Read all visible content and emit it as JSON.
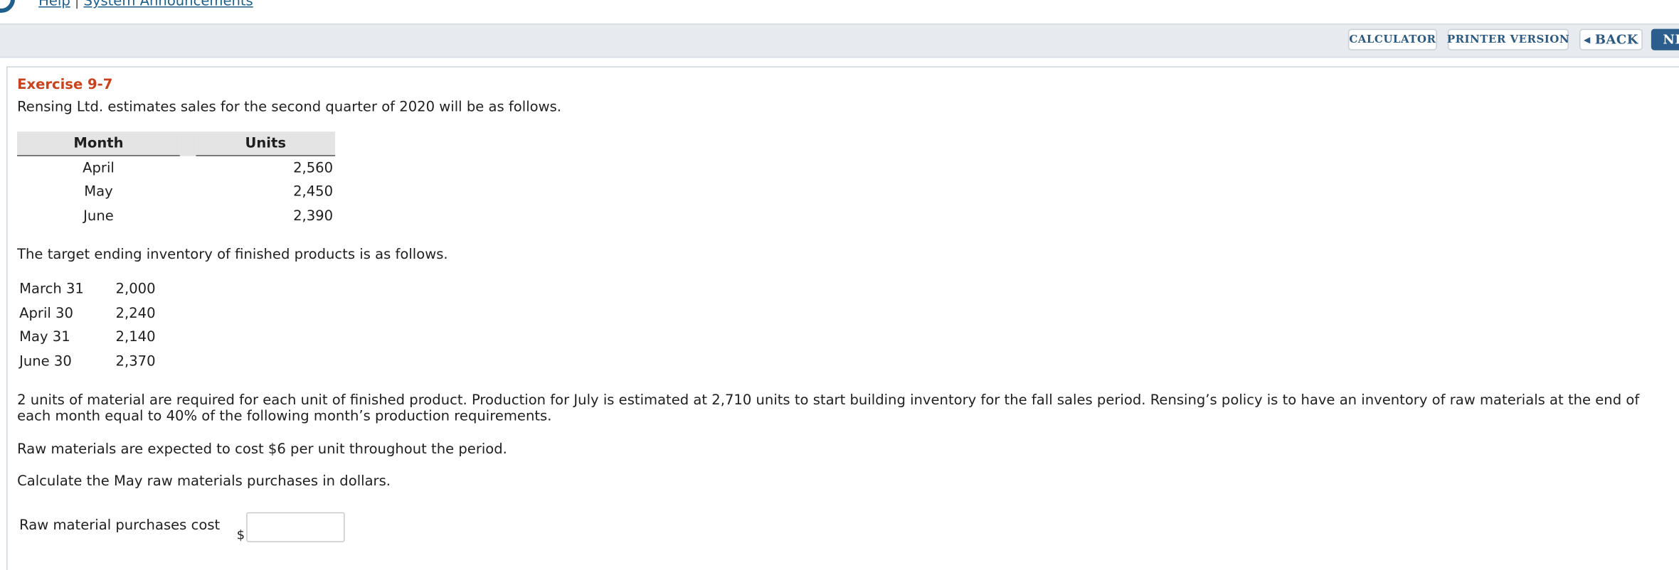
{
  "header": {
    "links": [
      "Help",
      "System Announcements"
    ],
    "separator": "|"
  },
  "toolbar": {
    "calculator_label": "CALCULATOR",
    "printer_label": "PRINTER VERSION",
    "back_label": "BACK",
    "next_label": "NE"
  },
  "exercise": {
    "title": "Exercise 9-7",
    "intro": "Rensing Ltd. estimates sales for the second quarter of 2020 will be as follows.",
    "sales_table": {
      "headers": [
        "Month",
        "Units"
      ],
      "rows": [
        {
          "month": "April",
          "units": "2,560"
        },
        {
          "month": "May",
          "units": "2,450"
        },
        {
          "month": "June",
          "units": "2,390"
        }
      ]
    },
    "inventory_intro": "The target ending inventory of finished products is as follows.",
    "inventory": [
      {
        "date": "March 31",
        "value": "2,000"
      },
      {
        "date": "April 30",
        "value": "2,240"
      },
      {
        "date": "May 31",
        "value": "2,140"
      },
      {
        "date": "June 30",
        "value": "2,370"
      }
    ],
    "paragraph_material": "2 units of material are required for each unit of finished product. Production for July is estimated at 2,710 units to start building inventory for the fall sales period. Rensing’s policy is to have an inventory of raw materials at the end of each month equal to 40% of the following month’s production requirements.",
    "paragraph_cost": "Raw materials are expected to cost $6 per unit throughout the period.",
    "question": "Calculate the May raw materials purchases in dollars.",
    "answer_label": "Raw material purchases cost",
    "currency_symbol": "$",
    "answer_value": ""
  },
  "colors": {
    "title": "#c8431c",
    "link": "#1f5f8b",
    "toolbar_bg": "#e7ebef",
    "next_button_bg": "#2b5e8c"
  }
}
